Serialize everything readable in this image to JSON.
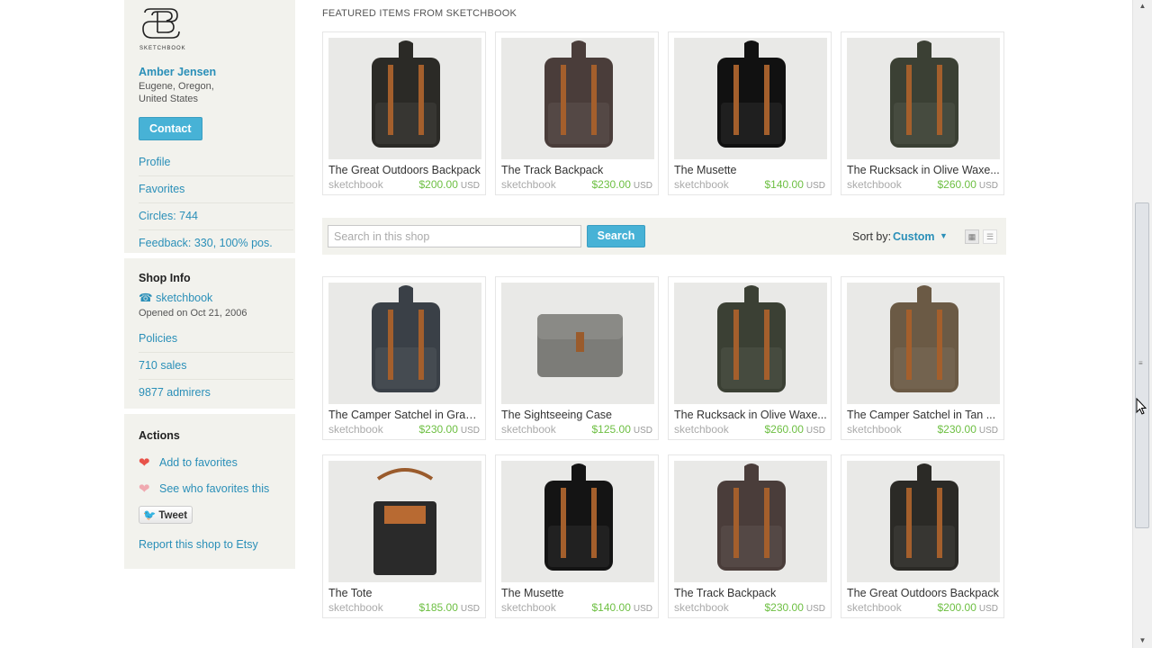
{
  "sidebar": {
    "logo_text": "SKETCHBOOK",
    "owner_name": "Amber Jensen",
    "location_line1": "Eugene, Oregon,",
    "location_line2": "United States",
    "contact_label": "Contact",
    "links": [
      {
        "label": "Profile"
      },
      {
        "label": "Favorites"
      },
      {
        "label": "Circles: 744"
      },
      {
        "label": "Feedback: 330, 100% pos."
      }
    ],
    "shop_info": {
      "title": "Shop Info",
      "shop_name": "sketchbook",
      "opened": "Opened on Oct 21, 2006",
      "links": [
        {
          "label": "Policies"
        },
        {
          "label": "710 sales"
        },
        {
          "label": "9877 admirers"
        }
      ]
    },
    "actions": {
      "title": "Actions",
      "add_favorites": "Add to favorites",
      "see_favorites": "See who favorites this",
      "tweet": "Tweet",
      "report": "Report this shop to Etsy"
    }
  },
  "featured": {
    "title": "FEATURED ITEMS FROM SKETCHBOOK",
    "items": [
      {
        "title": "The Great Outdoors Backpack",
        "shop": "sketchbook",
        "price": "$200.00",
        "currency": "USD"
      },
      {
        "title": "The Track Backpack",
        "shop": "sketchbook",
        "price": "$230.00",
        "currency": "USD"
      },
      {
        "title": "The Musette",
        "shop": "sketchbook",
        "price": "$140.00",
        "currency": "USD"
      },
      {
        "title": "The Rucksack in Olive Waxe...",
        "shop": "sketchbook",
        "price": "$260.00",
        "currency": "USD"
      }
    ]
  },
  "search": {
    "placeholder": "Search in this shop",
    "button": "Search",
    "sort_label": "Sort by:",
    "sort_value": "Custom"
  },
  "listing": {
    "items": [
      {
        "title": "The Camper Satchel in Gray ...",
        "shop": "sketchbook",
        "price": "$230.00",
        "currency": "USD"
      },
      {
        "title": "The Sightseeing Case",
        "shop": "sketchbook",
        "price": "$125.00",
        "currency": "USD"
      },
      {
        "title": "The Rucksack in Olive Waxe...",
        "shop": "sketchbook",
        "price": "$260.00",
        "currency": "USD"
      },
      {
        "title": "The Camper Satchel in Tan ...",
        "shop": "sketchbook",
        "price": "$230.00",
        "currency": "USD"
      },
      {
        "title": "The Tote",
        "shop": "sketchbook",
        "price": "$185.00",
        "currency": "USD"
      },
      {
        "title": "The Musette",
        "shop": "sketchbook",
        "price": "$140.00",
        "currency": "USD"
      },
      {
        "title": "The Track Backpack",
        "shop": "sketchbook",
        "price": "$230.00",
        "currency": "USD"
      },
      {
        "title": "The Great Outdoors Backpack",
        "shop": "sketchbook",
        "price": "$200.00",
        "currency": "USD"
      }
    ]
  },
  "colors": {
    "link": "#2a8fb8",
    "button": "#47b2d6",
    "price": "#6dbf42",
    "panel": "#f2f2ed"
  }
}
